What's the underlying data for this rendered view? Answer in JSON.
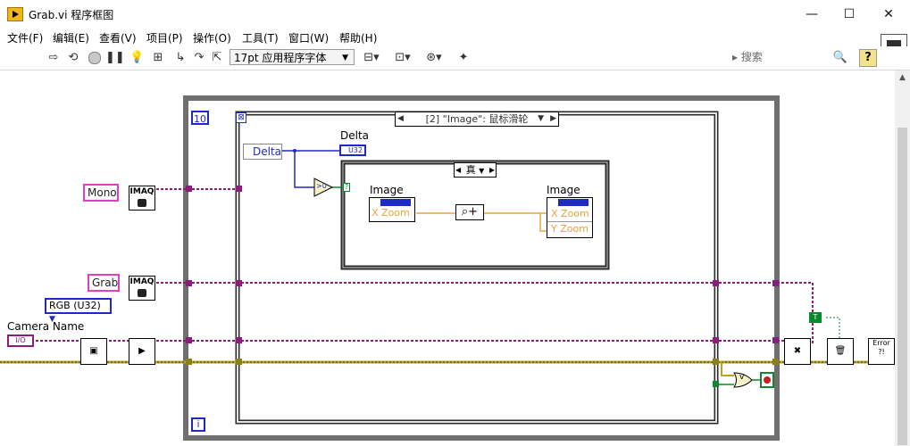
{
  "window": {
    "title": "Grab.vi 程序框图",
    "controls": {
      "minimize": "—",
      "maximize": "☐",
      "close": "✕"
    }
  },
  "menu": [
    "文件(F)",
    "编辑(E)",
    "查看(V)",
    "项目(P)",
    "操作(O)",
    "工具(T)",
    "窗口(W)",
    "帮助(H)"
  ],
  "toolbar": {
    "font_select": "17pt 应用程序字体",
    "search_placeholder": "搜索",
    "help": "?"
  },
  "diagram": {
    "loop_count_label": "10",
    "loop_iteration_label": "i",
    "event_case_selector": "[2] \"Image\": 鼠标滑轮",
    "case_selector": "真",
    "delta_terminal": "Delta",
    "delta_indicator_label": "Delta",
    "delta_indicator_type": "U32",
    "compare_node": ">0",
    "image_in_label": "Image",
    "image_in_prop": "X Zoom",
    "image_out_label": "Image",
    "image_out_prop1": "X Zoom",
    "image_out_prop2": "Y Zoom",
    "mono_const": "Mono",
    "grab_const": "Grab",
    "imaq_label": "IMAQ",
    "rgb_enum": "RGB (U32)",
    "camera_name_label": "Camera Name",
    "io_terminal": "I/O",
    "true_const": "T",
    "or_node": "v",
    "error_node": "Error"
  },
  "colors": {
    "pink_wire": "#8b1d7b",
    "yellow_wire": "#b7a521",
    "blue": "#1f2ac4",
    "orange": "#e8a33a",
    "green": "#0a8a2c"
  }
}
